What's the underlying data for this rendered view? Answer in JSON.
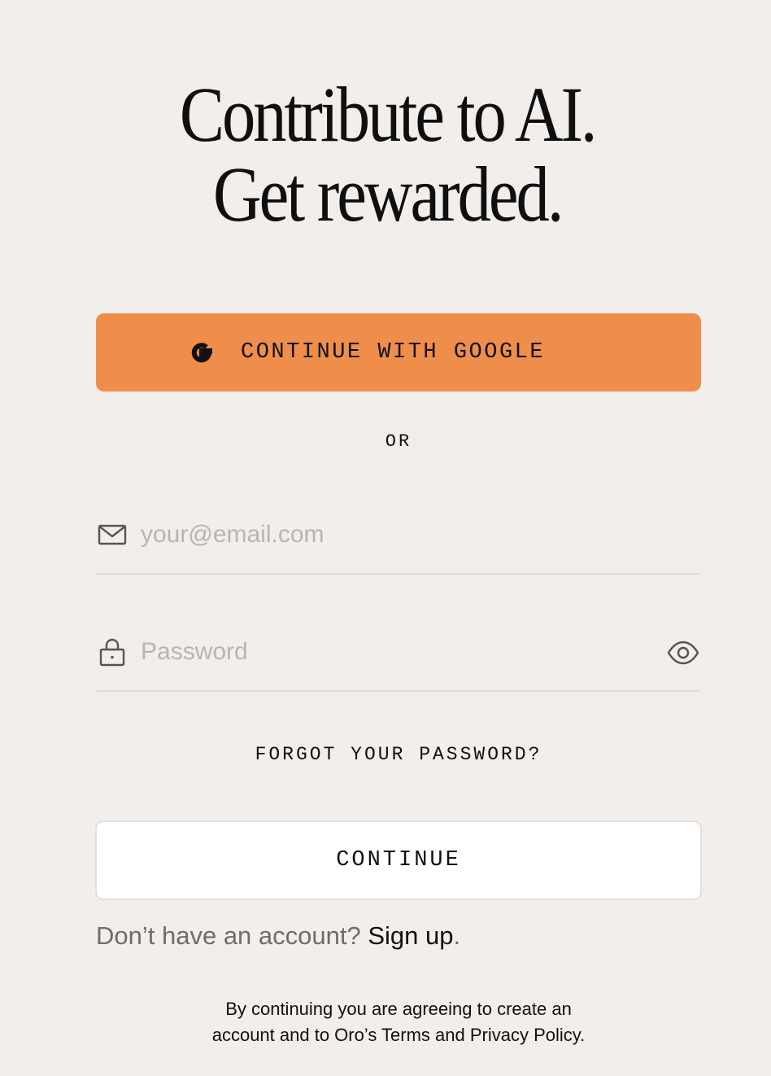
{
  "headline": {
    "line1": "Contribute to AI.",
    "line2": "Get rewarded."
  },
  "google_button": {
    "label": "CONTINUE WITH GOOGLE",
    "icon": "google-g-icon",
    "color": "#ef8d4a"
  },
  "divider": {
    "label": "OR"
  },
  "email_field": {
    "placeholder": "your@email.com",
    "value": "",
    "icon": "mail-icon"
  },
  "password_field": {
    "placeholder": "Password",
    "value": "",
    "icon": "lock-icon",
    "toggle_icon": "eye-icon"
  },
  "forgot_password": {
    "label": "FORGOT YOUR PASSWORD?"
  },
  "continue_button": {
    "label": "CONTINUE"
  },
  "signup": {
    "prompt": "Don’t have an account?",
    "link": "Sign up",
    "suffix": "."
  },
  "terms": {
    "line1": "By continuing you are agreeing to create an",
    "line2": "account and to Oro’s Terms and Privacy Policy."
  },
  "colors": {
    "background": "#f1eeeb",
    "accent": "#ef8d4a",
    "placeholder": "#b9b5b1",
    "muted_text": "#716c68"
  }
}
